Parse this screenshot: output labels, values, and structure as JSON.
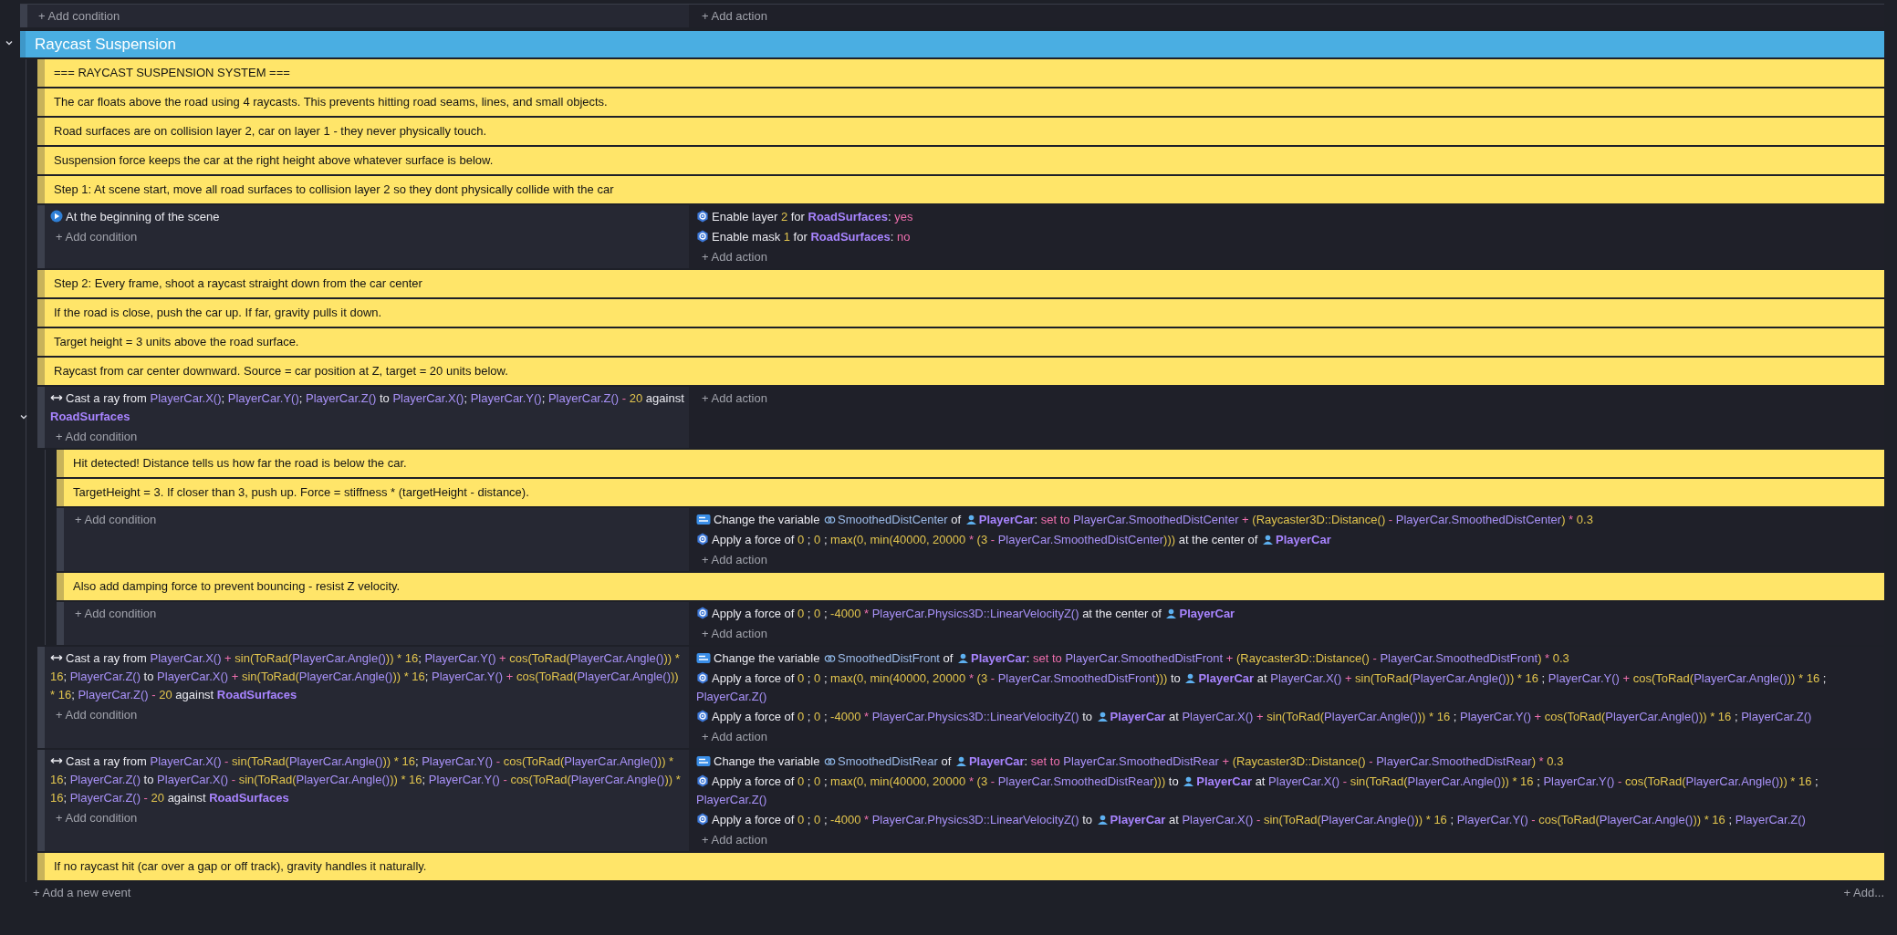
{
  "previous_event": {
    "add_condition": "+ Add condition",
    "add_action": "+ Add action"
  },
  "group": {
    "title": "Raycast Suspension",
    "expanded": true,
    "events": [
      {
        "kind": "comment",
        "text": "=== RAYCAST SUSPENSION SYSTEM ==="
      },
      {
        "kind": "comment",
        "text": "The car floats above the road using 4 raycasts. This prevents hitting road seams, lines, and small objects."
      },
      {
        "kind": "comment",
        "text": "Road surfaces are on collision layer 2, car on layer 1 - they never physically touch."
      },
      {
        "kind": "comment",
        "text": "Suspension force keeps the car at the right height above whatever surface is below."
      },
      {
        "kind": "comment",
        "text": "Step 1: At scene start, move all road surfaces to collision layer 2 so they dont physically collide with the car"
      },
      {
        "kind": "event",
        "conditions": [
          {
            "kind": "scene-start",
            "parts": [
              {
                "kind": "text",
                "text": "At the beginning of the scene"
              }
            ]
          }
        ],
        "add_condition": "+ Add condition",
        "actions": [
          {
            "kind": "physics",
            "parts": [
              {
                "kind": "text",
                "text": "Enable layer "
              },
              {
                "kind": "num",
                "text": "2"
              },
              {
                "kind": "text",
                "text": " for "
              },
              {
                "kind": "object",
                "text": "RoadSurfaces"
              },
              {
                "kind": "text",
                "text": ": "
              },
              {
                "kind": "op",
                "text": "yes"
              }
            ]
          },
          {
            "kind": "physics",
            "parts": [
              {
                "kind": "text",
                "text": "Enable mask "
              },
              {
                "kind": "num",
                "text": "1"
              },
              {
                "kind": "text",
                "text": " for "
              },
              {
                "kind": "object",
                "text": "RoadSurfaces"
              },
              {
                "kind": "text",
                "text": ": "
              },
              {
                "kind": "op",
                "text": "no"
              }
            ]
          }
        ],
        "add_action": "+ Add action"
      },
      {
        "kind": "comment",
        "text": "Step 2: Every frame, shoot a raycast straight down from the car center"
      },
      {
        "kind": "comment",
        "text": "If the road is close, push the car up. If far, gravity pulls it down."
      },
      {
        "kind": "comment",
        "text": "Target height = 3 units above the road surface."
      },
      {
        "kind": "comment",
        "text": "Raycast from car center downward. Source = car position at Z, target = 20 units below."
      },
      {
        "kind": "event",
        "expanded": true,
        "conditions": [
          {
            "kind": "raycast",
            "parts": [
              {
                "kind": "text",
                "text": "Cast a ray from "
              },
              {
                "kind": "expr",
                "text": "PlayerCar.X()"
              },
              {
                "kind": "text",
                "text": "; "
              },
              {
                "kind": "expr",
                "text": "PlayerCar.Y()"
              },
              {
                "kind": "text",
                "text": "; "
              },
              {
                "kind": "expr",
                "text": "PlayerCar.Z()"
              },
              {
                "kind": "text",
                "text": " to "
              },
              {
                "kind": "expr",
                "text": "PlayerCar.X()"
              },
              {
                "kind": "text",
                "text": "; "
              },
              {
                "kind": "expr",
                "text": "PlayerCar.Y()"
              },
              {
                "kind": "text",
                "text": "; "
              },
              {
                "kind": "expr",
                "text": "PlayerCar.Z()"
              },
              {
                "kind": "op",
                "text": " - "
              },
              {
                "kind": "num",
                "text": "20"
              },
              {
                "kind": "text",
                "text": " against "
              },
              {
                "kind": "object",
                "text": "RoadSurfaces"
              }
            ]
          }
        ],
        "add_condition": "+ Add condition",
        "add_action": "+ Add action",
        "children": [
          {
            "kind": "comment",
            "text": "Hit detected! Distance tells us how far the road is below the car."
          },
          {
            "kind": "comment",
            "text": "TargetHeight = 3. If closer than 3, push up. Force = stiffness * (targetHeight - distance)."
          },
          {
            "kind": "event",
            "add_condition": "+ Add condition",
            "actions": [
              {
                "kind": "variable",
                "parts": [
                  {
                    "kind": "text",
                    "text": "Change the variable "
                  },
                  {
                    "kind": "variable",
                    "text": "SmoothedDistCenter"
                  },
                  {
                    "kind": "text",
                    "text": " of "
                  },
                  {
                    "kind": "object",
                    "icon": true,
                    "text": "PlayerCar"
                  },
                  {
                    "kind": "text",
                    "text": ": "
                  },
                  {
                    "kind": "op",
                    "text": "set to "
                  },
                  {
                    "kind": "expr",
                    "text": "PlayerCar.SmoothedDistCenter"
                  },
                  {
                    "kind": "op",
                    "text": " + "
                  },
                  {
                    "kind": "num",
                    "text": "(Raycaster3D::Distance()"
                  },
                  {
                    "kind": "op",
                    "text": " - "
                  },
                  {
                    "kind": "expr",
                    "text": "PlayerCar.SmoothedDistCenter"
                  },
                  {
                    "kind": "num",
                    "text": ")"
                  },
                  {
                    "kind": "op",
                    "text": " * "
                  },
                  {
                    "kind": "num",
                    "text": "0.3"
                  }
                ]
              },
              {
                "kind": "physics",
                "parts": [
                  {
                    "kind": "text",
                    "text": "Apply a force of "
                  },
                  {
                    "kind": "num",
                    "text": "0"
                  },
                  {
                    "kind": "text",
                    "text": " ; "
                  },
                  {
                    "kind": "num",
                    "text": "0"
                  },
                  {
                    "kind": "text",
                    "text": " ; "
                  },
                  {
                    "kind": "num",
                    "text": "max(0, min(40000, 20000"
                  },
                  {
                    "kind": "op",
                    "text": " * "
                  },
                  {
                    "kind": "num",
                    "text": "(3"
                  },
                  {
                    "kind": "op",
                    "text": " - "
                  },
                  {
                    "kind": "expr",
                    "text": "PlayerCar.SmoothedDistCenter"
                  },
                  {
                    "kind": "num",
                    "text": ")))"
                  },
                  {
                    "kind": "text",
                    "text": " at the center of "
                  },
                  {
                    "kind": "object",
                    "icon": true,
                    "text": "PlayerCar"
                  }
                ]
              }
            ],
            "add_action": "+ Add action"
          },
          {
            "kind": "comment",
            "text": "Also add damping force to prevent bouncing - resist Z velocity."
          },
          {
            "kind": "event",
            "add_condition": "+ Add condition",
            "actions": [
              {
                "kind": "physics",
                "parts": [
                  {
                    "kind": "text",
                    "text": "Apply a force of "
                  },
                  {
                    "kind": "num",
                    "text": "0"
                  },
                  {
                    "kind": "text",
                    "text": " ; "
                  },
                  {
                    "kind": "num",
                    "text": "0"
                  },
                  {
                    "kind": "text",
                    "text": " ; "
                  },
                  {
                    "kind": "num",
                    "text": "-4000"
                  },
                  {
                    "kind": "op",
                    "text": " * "
                  },
                  {
                    "kind": "expr",
                    "text": "PlayerCar.Physics3D::LinearVelocityZ()"
                  },
                  {
                    "kind": "text",
                    "text": " at the center of "
                  },
                  {
                    "kind": "object",
                    "icon": true,
                    "text": "PlayerCar"
                  }
                ]
              }
            ],
            "add_action": "+ Add action"
          }
        ]
      },
      {
        "kind": "event",
        "conditions": [
          {
            "kind": "raycast",
            "parts": [
              {
                "kind": "text",
                "text": "Cast a ray from "
              },
              {
                "kind": "expr",
                "text": "PlayerCar.X()"
              },
              {
                "kind": "op",
                "text": " + "
              },
              {
                "kind": "num",
                "text": "sin(ToRad("
              },
              {
                "kind": "expr",
                "text": "PlayerCar.Angle()"
              },
              {
                "kind": "num",
                "text": ")) * 16"
              },
              {
                "kind": "text",
                "text": "; "
              },
              {
                "kind": "expr",
                "text": "PlayerCar.Y()"
              },
              {
                "kind": "op",
                "text": " + "
              },
              {
                "kind": "num",
                "text": "cos(ToRad("
              },
              {
                "kind": "expr",
                "text": "PlayerCar.Angle()"
              },
              {
                "kind": "num",
                "text": ")) * 16"
              },
              {
                "kind": "text",
                "text": "; "
              },
              {
                "kind": "expr",
                "text": "PlayerCar.Z()"
              },
              {
                "kind": "text",
                "text": " to "
              },
              {
                "kind": "expr",
                "text": "PlayerCar.X()"
              },
              {
                "kind": "op",
                "text": " + "
              },
              {
                "kind": "num",
                "text": "sin(ToRad("
              },
              {
                "kind": "expr",
                "text": "PlayerCar.Angle()"
              },
              {
                "kind": "num",
                "text": ")) * 16"
              },
              {
                "kind": "text",
                "text": "; "
              },
              {
                "kind": "expr",
                "text": "PlayerCar.Y()"
              },
              {
                "kind": "op",
                "text": " + "
              },
              {
                "kind": "num",
                "text": "cos(ToRad("
              },
              {
                "kind": "expr",
                "text": "PlayerCar.Angle()"
              },
              {
                "kind": "num",
                "text": ")) * 16"
              },
              {
                "kind": "text",
                "text": "; "
              },
              {
                "kind": "expr",
                "text": "PlayerCar.Z()"
              },
              {
                "kind": "op",
                "text": " - "
              },
              {
                "kind": "num",
                "text": "20"
              },
              {
                "kind": "text",
                "text": " against "
              },
              {
                "kind": "object",
                "text": "RoadSurfaces"
              }
            ]
          }
        ],
        "add_condition": "+ Add condition",
        "actions": [
          {
            "kind": "variable",
            "parts": [
              {
                "kind": "text",
                "text": "Change the variable "
              },
              {
                "kind": "variable",
                "text": "SmoothedDistFront"
              },
              {
                "kind": "text",
                "text": " of "
              },
              {
                "kind": "object",
                "icon": true,
                "text": "PlayerCar"
              },
              {
                "kind": "text",
                "text": ": "
              },
              {
                "kind": "op",
                "text": "set to "
              },
              {
                "kind": "expr",
                "text": "PlayerCar.SmoothedDistFront"
              },
              {
                "kind": "op",
                "text": " + "
              },
              {
                "kind": "num",
                "text": "(Raycaster3D::Distance()"
              },
              {
                "kind": "op",
                "text": " - "
              },
              {
                "kind": "expr",
                "text": "PlayerCar.SmoothedDistFront"
              },
              {
                "kind": "num",
                "text": ")"
              },
              {
                "kind": "op",
                "text": " * "
              },
              {
                "kind": "num",
                "text": "0.3"
              }
            ]
          },
          {
            "kind": "physics",
            "parts": [
              {
                "kind": "text",
                "text": "Apply a force of "
              },
              {
                "kind": "num",
                "text": "0"
              },
              {
                "kind": "text",
                "text": " ; "
              },
              {
                "kind": "num",
                "text": "0"
              },
              {
                "kind": "text",
                "text": " ; "
              },
              {
                "kind": "num",
                "text": "max(0, min(40000, 20000"
              },
              {
                "kind": "op",
                "text": " * "
              },
              {
                "kind": "num",
                "text": "(3"
              },
              {
                "kind": "op",
                "text": " - "
              },
              {
                "kind": "expr",
                "text": "PlayerCar.SmoothedDistFront"
              },
              {
                "kind": "num",
                "text": ")))"
              },
              {
                "kind": "text",
                "text": " to "
              },
              {
                "kind": "object",
                "icon": true,
                "text": "PlayerCar"
              },
              {
                "kind": "text",
                "text": " at "
              },
              {
                "kind": "expr",
                "text": "PlayerCar.X()"
              },
              {
                "kind": "op",
                "text": " + "
              },
              {
                "kind": "num",
                "text": "sin(ToRad("
              },
              {
                "kind": "expr",
                "text": "PlayerCar.Angle()"
              },
              {
                "kind": "num",
                "text": ")) * 16"
              },
              {
                "kind": "text",
                "text": " ; "
              },
              {
                "kind": "expr",
                "text": "PlayerCar.Y()"
              },
              {
                "kind": "op",
                "text": " + "
              },
              {
                "kind": "num",
                "text": "cos(ToRad("
              },
              {
                "kind": "expr",
                "text": "PlayerCar.Angle()"
              },
              {
                "kind": "num",
                "text": ")) * 16"
              },
              {
                "kind": "text",
                "text": " ; "
              },
              {
                "kind": "expr",
                "text": "PlayerCar.Z()"
              }
            ]
          },
          {
            "kind": "physics",
            "parts": [
              {
                "kind": "text",
                "text": "Apply a force of "
              },
              {
                "kind": "num",
                "text": "0"
              },
              {
                "kind": "text",
                "text": " ; "
              },
              {
                "kind": "num",
                "text": "0"
              },
              {
                "kind": "text",
                "text": " ; "
              },
              {
                "kind": "num",
                "text": "-4000"
              },
              {
                "kind": "op",
                "text": " * "
              },
              {
                "kind": "expr",
                "text": "PlayerCar.Physics3D::LinearVelocityZ()"
              },
              {
                "kind": "text",
                "text": " to "
              },
              {
                "kind": "object",
                "icon": true,
                "text": "PlayerCar"
              },
              {
                "kind": "text",
                "text": " at "
              },
              {
                "kind": "expr",
                "text": "PlayerCar.X()"
              },
              {
                "kind": "op",
                "text": " + "
              },
              {
                "kind": "num",
                "text": "sin(ToRad("
              },
              {
                "kind": "expr",
                "text": "PlayerCar.Angle()"
              },
              {
                "kind": "num",
                "text": ")) * 16"
              },
              {
                "kind": "text",
                "text": " ; "
              },
              {
                "kind": "expr",
                "text": "PlayerCar.Y()"
              },
              {
                "kind": "op",
                "text": " + "
              },
              {
                "kind": "num",
                "text": "cos(ToRad("
              },
              {
                "kind": "expr",
                "text": "PlayerCar.Angle()"
              },
              {
                "kind": "num",
                "text": ")) * 16"
              },
              {
                "kind": "text",
                "text": " ; "
              },
              {
                "kind": "expr",
                "text": "PlayerCar.Z()"
              }
            ]
          }
        ],
        "add_action": "+ Add action"
      },
      {
        "kind": "event",
        "conditions": [
          {
            "kind": "raycast",
            "parts": [
              {
                "kind": "text",
                "text": "Cast a ray from "
              },
              {
                "kind": "expr",
                "text": "PlayerCar.X()"
              },
              {
                "kind": "op",
                "text": " - "
              },
              {
                "kind": "num",
                "text": "sin(ToRad("
              },
              {
                "kind": "expr",
                "text": "PlayerCar.Angle()"
              },
              {
                "kind": "num",
                "text": ")) * 16"
              },
              {
                "kind": "text",
                "text": "; "
              },
              {
                "kind": "expr",
                "text": "PlayerCar.Y()"
              },
              {
                "kind": "op",
                "text": " - "
              },
              {
                "kind": "num",
                "text": "cos(ToRad("
              },
              {
                "kind": "expr",
                "text": "PlayerCar.Angle()"
              },
              {
                "kind": "num",
                "text": ")) * 16"
              },
              {
                "kind": "text",
                "text": "; "
              },
              {
                "kind": "expr",
                "text": "PlayerCar.Z()"
              },
              {
                "kind": "text",
                "text": " to "
              },
              {
                "kind": "expr",
                "text": "PlayerCar.X()"
              },
              {
                "kind": "op",
                "text": " - "
              },
              {
                "kind": "num",
                "text": "sin(ToRad("
              },
              {
                "kind": "expr",
                "text": "PlayerCar.Angle()"
              },
              {
                "kind": "num",
                "text": ")) * 16"
              },
              {
                "kind": "text",
                "text": "; "
              },
              {
                "kind": "expr",
                "text": "PlayerCar.Y()"
              },
              {
                "kind": "op",
                "text": " - "
              },
              {
                "kind": "num",
                "text": "cos(ToRad("
              },
              {
                "kind": "expr",
                "text": "PlayerCar.Angle()"
              },
              {
                "kind": "num",
                "text": ")) * 16"
              },
              {
                "kind": "text",
                "text": "; "
              },
              {
                "kind": "expr",
                "text": "PlayerCar.Z()"
              },
              {
                "kind": "op",
                "text": " - "
              },
              {
                "kind": "num",
                "text": "20"
              },
              {
                "kind": "text",
                "text": " against "
              },
              {
                "kind": "object",
                "text": "RoadSurfaces"
              }
            ]
          }
        ],
        "add_condition": "+ Add condition",
        "actions": [
          {
            "kind": "variable",
            "parts": [
              {
                "kind": "text",
                "text": "Change the variable "
              },
              {
                "kind": "variable",
                "text": "SmoothedDistRear"
              },
              {
                "kind": "text",
                "text": " of "
              },
              {
                "kind": "object",
                "icon": true,
                "text": "PlayerCar"
              },
              {
                "kind": "text",
                "text": ": "
              },
              {
                "kind": "op",
                "text": "set to "
              },
              {
                "kind": "expr",
                "text": "PlayerCar.SmoothedDistRear"
              },
              {
                "kind": "op",
                "text": " + "
              },
              {
                "kind": "num",
                "text": "(Raycaster3D::Distance()"
              },
              {
                "kind": "op",
                "text": " - "
              },
              {
                "kind": "expr",
                "text": "PlayerCar.SmoothedDistRear"
              },
              {
                "kind": "num",
                "text": ")"
              },
              {
                "kind": "op",
                "text": " * "
              },
              {
                "kind": "num",
                "text": "0.3"
              }
            ]
          },
          {
            "kind": "physics",
            "parts": [
              {
                "kind": "text",
                "text": "Apply a force of "
              },
              {
                "kind": "num",
                "text": "0"
              },
              {
                "kind": "text",
                "text": " ; "
              },
              {
                "kind": "num",
                "text": "0"
              },
              {
                "kind": "text",
                "text": " ; "
              },
              {
                "kind": "num",
                "text": "max(0, min(40000, 20000"
              },
              {
                "kind": "op",
                "text": " * "
              },
              {
                "kind": "num",
                "text": "(3"
              },
              {
                "kind": "op",
                "text": " - "
              },
              {
                "kind": "expr",
                "text": "PlayerCar.SmoothedDistRear"
              },
              {
                "kind": "num",
                "text": ")))"
              },
              {
                "kind": "text",
                "text": " to "
              },
              {
                "kind": "object",
                "icon": true,
                "text": "PlayerCar"
              },
              {
                "kind": "text",
                "text": " at "
              },
              {
                "kind": "expr",
                "text": "PlayerCar.X()"
              },
              {
                "kind": "op",
                "text": " - "
              },
              {
                "kind": "num",
                "text": "sin(ToRad("
              },
              {
                "kind": "expr",
                "text": "PlayerCar.Angle()"
              },
              {
                "kind": "num",
                "text": ")) * 16"
              },
              {
                "kind": "text",
                "text": " ; "
              },
              {
                "kind": "expr",
                "text": "PlayerCar.Y()"
              },
              {
                "kind": "op",
                "text": " - "
              },
              {
                "kind": "num",
                "text": "cos(ToRad("
              },
              {
                "kind": "expr",
                "text": "PlayerCar.Angle()"
              },
              {
                "kind": "num",
                "text": ")) * 16"
              },
              {
                "kind": "text",
                "text": " ; "
              },
              {
                "kind": "expr",
                "text": "PlayerCar.Z()"
              }
            ]
          },
          {
            "kind": "physics",
            "parts": [
              {
                "kind": "text",
                "text": "Apply a force of "
              },
              {
                "kind": "num",
                "text": "0"
              },
              {
                "kind": "text",
                "text": " ; "
              },
              {
                "kind": "num",
                "text": "0"
              },
              {
                "kind": "text",
                "text": " ; "
              },
              {
                "kind": "num",
                "text": "-4000"
              },
              {
                "kind": "op",
                "text": " * "
              },
              {
                "kind": "expr",
                "text": "PlayerCar.Physics3D::LinearVelocityZ()"
              },
              {
                "kind": "text",
                "text": " to "
              },
              {
                "kind": "object",
                "icon": true,
                "text": "PlayerCar"
              },
              {
                "kind": "text",
                "text": " at "
              },
              {
                "kind": "expr",
                "text": "PlayerCar.X()"
              },
              {
                "kind": "op",
                "text": " - "
              },
              {
                "kind": "num",
                "text": "sin(ToRad("
              },
              {
                "kind": "expr",
                "text": "PlayerCar.Angle()"
              },
              {
                "kind": "num",
                "text": ")) * 16"
              },
              {
                "kind": "text",
                "text": " ; "
              },
              {
                "kind": "expr",
                "text": "PlayerCar.Y()"
              },
              {
                "kind": "op",
                "text": " - "
              },
              {
                "kind": "num",
                "text": "cos(ToRad("
              },
              {
                "kind": "expr",
                "text": "PlayerCar.Angle()"
              },
              {
                "kind": "num",
                "text": ")) * 16"
              },
              {
                "kind": "text",
                "text": " ; "
              },
              {
                "kind": "expr",
                "text": "PlayerCar.Z()"
              }
            ]
          }
        ],
        "add_action": "+ Add action"
      },
      {
        "kind": "comment",
        "text": "If no raycast hit (car over a gap or off track), gravity handles it naturally."
      }
    ]
  },
  "add_event": "+ Add a new event",
  "add_other": "+ Add..."
}
